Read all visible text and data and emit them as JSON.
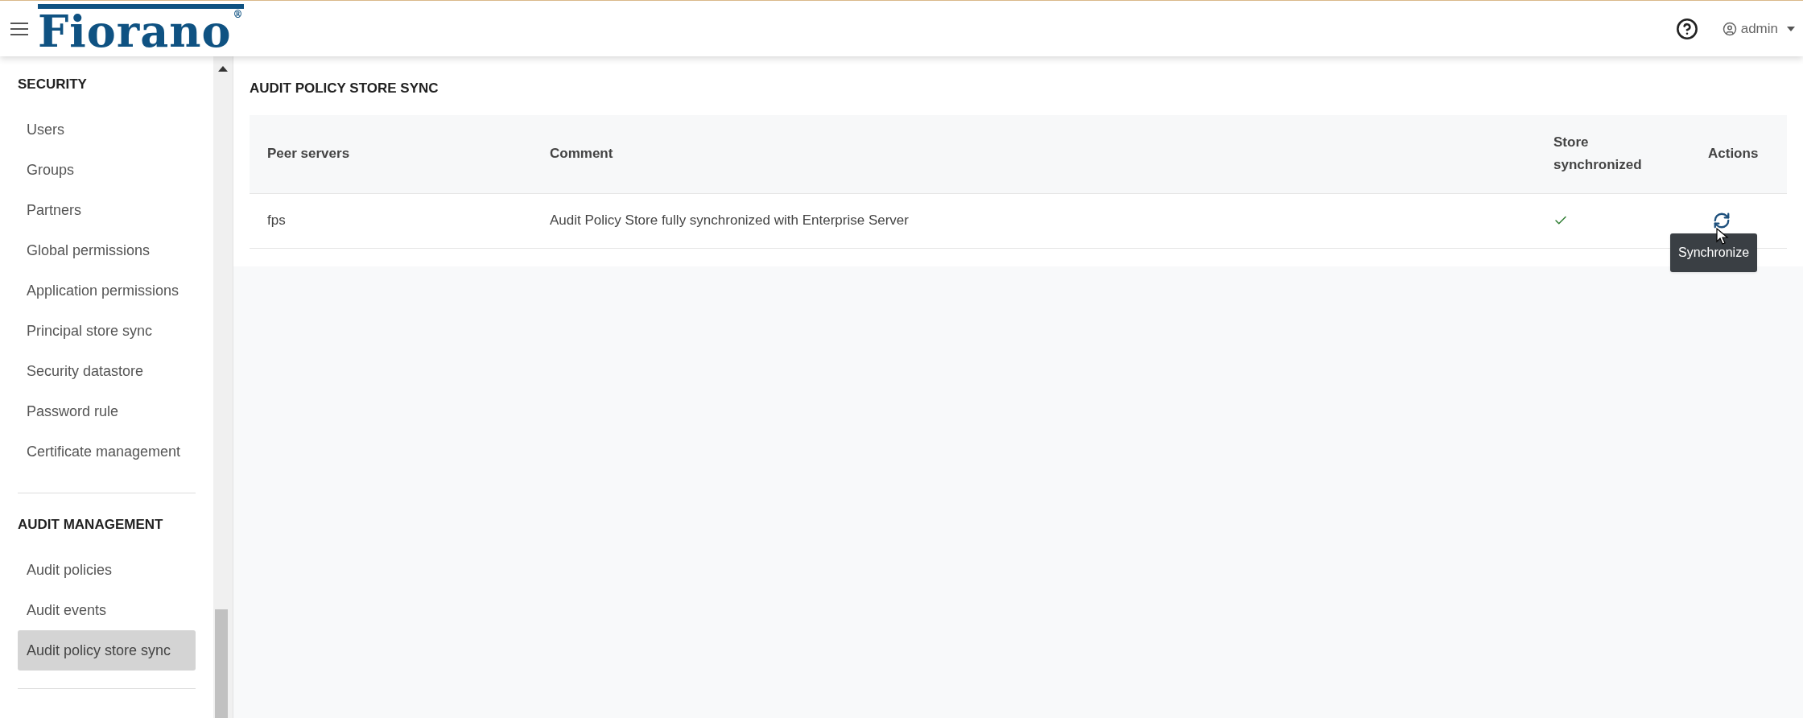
{
  "header": {
    "logo": "Fiorano",
    "logo_mark": "®",
    "user": "admin"
  },
  "sidebar": {
    "sections": [
      {
        "title": "SECURITY",
        "items": [
          {
            "label": "Users",
            "selected": false
          },
          {
            "label": "Groups",
            "selected": false
          },
          {
            "label": "Partners",
            "selected": false
          },
          {
            "label": "Global permissions",
            "selected": false
          },
          {
            "label": "Application permissions",
            "selected": false
          },
          {
            "label": "Principal store sync",
            "selected": false
          },
          {
            "label": "Security datastore",
            "selected": false
          },
          {
            "label": "Password rule",
            "selected": false
          },
          {
            "label": "Certificate management",
            "selected": false
          }
        ]
      },
      {
        "title": "AUDIT MANAGEMENT",
        "items": [
          {
            "label": "Audit policies",
            "selected": false
          },
          {
            "label": "Audit events",
            "selected": false
          },
          {
            "label": "Audit policy store sync",
            "selected": true
          }
        ]
      }
    ]
  },
  "page": {
    "title": "AUDIT POLICY STORE SYNC",
    "table": {
      "columns": [
        "Peer servers",
        "Comment",
        "Store synchronized",
        "Actions"
      ],
      "rows": [
        {
          "peer": "fps",
          "comment": "Audit Policy Store fully synchronized with Enterprise Server",
          "synchronized": true
        }
      ]
    },
    "tooltip": "Synchronize"
  }
}
